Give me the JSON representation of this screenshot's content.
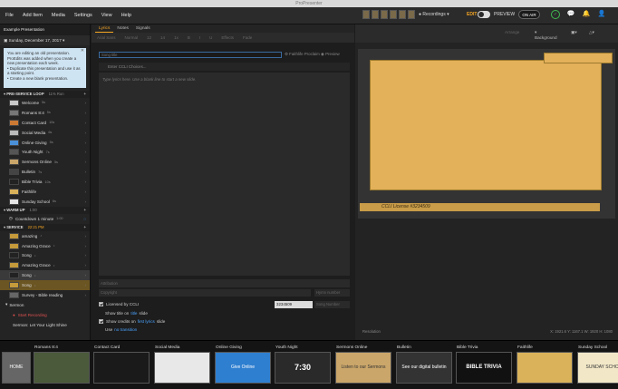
{
  "window": {
    "title": "ProPresenter"
  },
  "menu": [
    "File",
    "Add Item",
    "Media",
    "Settings",
    "View",
    "Help"
  ],
  "toolbar": {
    "recordings": "Recordings",
    "edit": "EDIT",
    "preview": "PREVIEW",
    "on_air": "ON AIR"
  },
  "sidebar": {
    "presentation_title": "Example Presentation",
    "date": "Sunday, December 17, 2017",
    "notice": {
      "line1": "You are editing an old presentation. ProEdits was added when you create a new presentation each week.",
      "line2": "Duplicate this presentation and use it as a starting point.",
      "line3": "Create a new blank presentation."
    },
    "pre_loop": {
      "title": "PRE-SERVICE LOOP",
      "count": "11% Run",
      "items": [
        {
          "label": "Welcome",
          "dur": "5s",
          "c": "#c9c9c9"
        },
        {
          "label": "Romans 8:4",
          "dur": "5s",
          "c": "#777"
        },
        {
          "label": "Contact Card",
          "dur": "10s",
          "c": "#cc7a33"
        },
        {
          "label": "Social Media",
          "dur": "6s",
          "c": "#bbb"
        },
        {
          "label": "Online Giving",
          "dur": "5s",
          "c": "#4a90d9"
        },
        {
          "label": "Youth Night",
          "dur": "7s",
          "c": "#555"
        },
        {
          "label": "Sermons Online",
          "dur": "5s",
          "c": "#caa66a"
        },
        {
          "label": "Bulletin",
          "dur": "7s",
          "c": "#444"
        },
        {
          "label": "Bible Trivia",
          "dur": "10s",
          "c": "#222"
        },
        {
          "label": "Faithlife",
          "dur": "",
          "c": "#d9b25a"
        },
        {
          "label": "Sunday School",
          "dur": "6s",
          "c": "#e6e6e6"
        }
      ]
    },
    "warmup": {
      "title": "WARM UP",
      "count": "1:00",
      "items": [
        {
          "label": "Countdown 1 minute",
          "dur": "1:00"
        }
      ]
    },
    "service": {
      "title": "SERVICE",
      "count": "22:21 PM",
      "items": [
        {
          "label": "amazing",
          "c": "#c49a3a"
        },
        {
          "label": "Amazing Grace",
          "c": "#c49a3a"
        },
        {
          "label": "Song",
          "c": "#222"
        },
        {
          "label": "Amazing Grace",
          "c": "#c49a3a"
        },
        {
          "label": "Song",
          "c": "#222"
        },
        {
          "label": "Song",
          "c": "#c49a3a"
        },
        {
          "label": "Survey - Bible reading",
          "c": "#666"
        }
      ]
    },
    "sermon": {
      "title": "Sermon",
      "items": [
        {
          "label": "Start Recording"
        },
        {
          "label": "Sermon: Let Your Light Shine"
        }
      ]
    }
  },
  "editor": {
    "tabs": [
      "Lyrics",
      "Notes",
      "Signals"
    ],
    "format": [
      "Arial Sans",
      "Normal",
      "12",
      "14",
      "1x",
      "B",
      "I",
      "U",
      "Effects",
      "Fade"
    ],
    "song_title_placeholder": "Song title",
    "fluency": "Faithlife Proclaim",
    "preview": "Preview",
    "ccli_placeholder": "Enter CCLI Choices...",
    "lyrics_placeholder": "Type lyrics here. Use a blank line to start a new slide.",
    "attribution": "Attribution",
    "copyright": "Copyright",
    "hymn_number": "Hymn number",
    "licensed": "Licensed by CCLI",
    "license_number": "3234509",
    "song_number": "Song Number",
    "show_title": "Show title on",
    "title_slide": "title",
    "slide_word": "slide",
    "show_credits": "Show credits on",
    "first_lyrics": "first lyrics",
    "use": "Use",
    "transition": "no transition"
  },
  "preview_pane": {
    "arrange": "Arrange",
    "background": "Background",
    "license_text": "CCLI License #3234509",
    "resolution": "Resolution",
    "coords": "X: 1921.6 Y: 1167.1 W: 1920 H: 1080"
  },
  "strip": [
    {
      "label": "",
      "title": "HOME",
      "c": "#666"
    },
    {
      "label": "Romans 8:4",
      "title": "",
      "c": "#4a5a3a"
    },
    {
      "label": "Contact Card",
      "title": "",
      "c": "#1a1a1a"
    },
    {
      "label": "Social Media",
      "title": "",
      "c": "#e8e8e8"
    },
    {
      "label": "Online Giving",
      "title": "Give Online",
      "c": "#2f7fd0"
    },
    {
      "label": "Youth Night",
      "title": "7:30",
      "c": "#2a2a2a"
    },
    {
      "label": "Sermons Online",
      "title": "Listen to our Sermons Online",
      "c": "#caa66a"
    },
    {
      "label": "Bulletin",
      "title": "See our digital bulletin",
      "c": "#333"
    },
    {
      "label": "Bible Trivia",
      "title": "BIBLE TRIVIA",
      "c": "#111"
    },
    {
      "label": "Faithlife",
      "title": "",
      "c": "#d9b25a"
    },
    {
      "label": "Sunday School",
      "title": "SUNDAY SCHOOL",
      "c": "#f2e8c8"
    }
  ]
}
